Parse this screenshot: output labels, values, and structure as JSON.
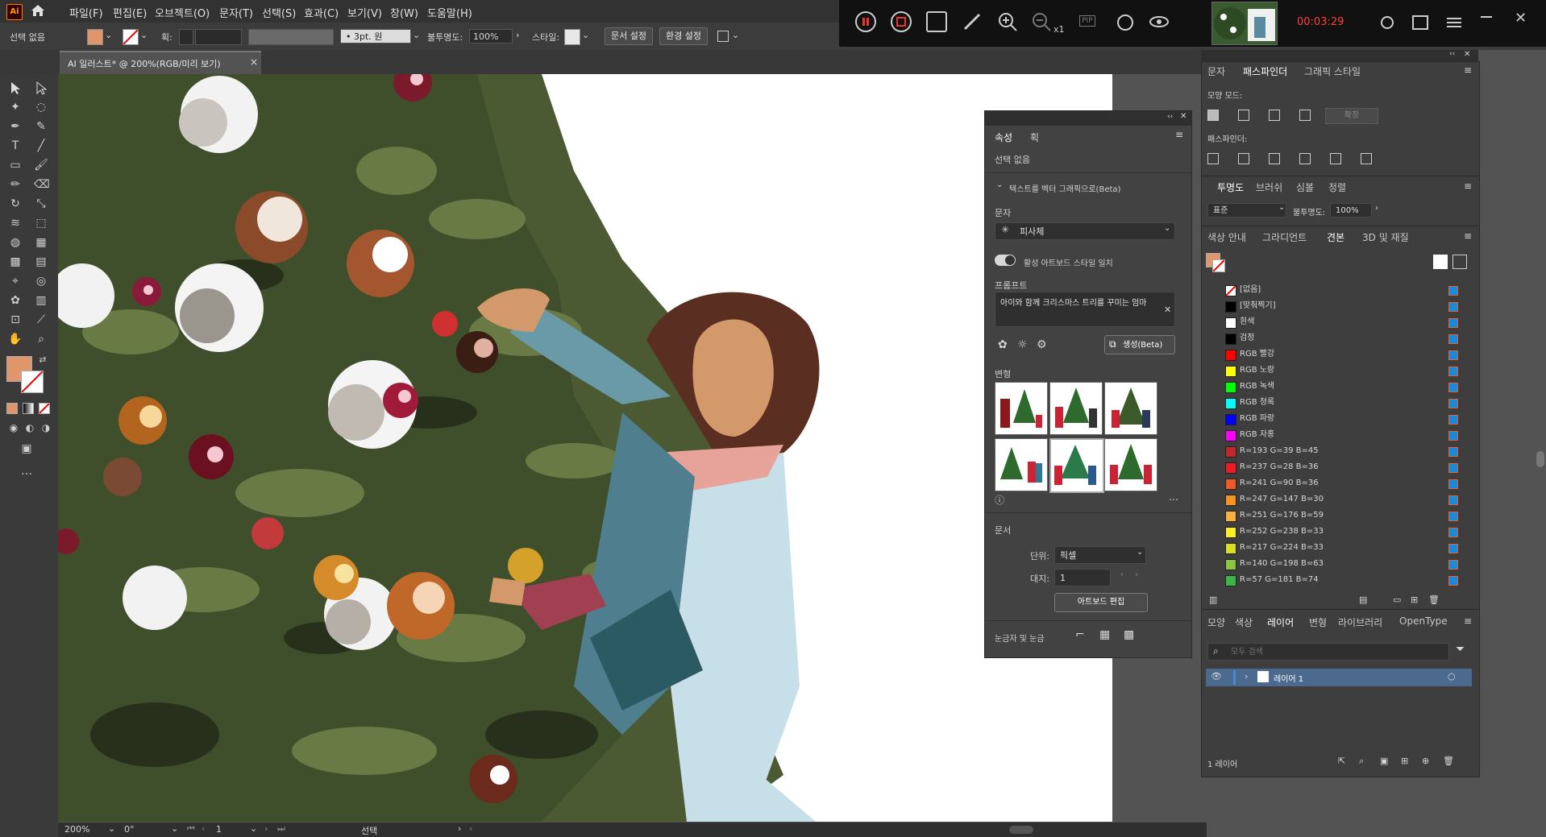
{
  "menu": {
    "logo": "Ai",
    "items": [
      "파일(F)",
      "편집(E)",
      "오브젝트(O)",
      "문자(T)",
      "선택(S)",
      "효과(C)",
      "보기(V)",
      "창(W)",
      "도움말(H)"
    ]
  },
  "control_bar": {
    "selection": "선택 없음",
    "stroke_label": "획:",
    "brush": "3pt. 원",
    "opacity_label": "불투명도:",
    "opacity_value": "100%",
    "style_label": "스타일:",
    "doc_setup": "문서 설정",
    "prefs": "환경 설정"
  },
  "recorder": {
    "time": "00:03:29",
    "zoom_suffix": "x1",
    "pip": "PIP"
  },
  "document_tab": {
    "title": "AI 일러스트* @ 200%(RGB/미리 보기)",
    "close": "×"
  },
  "status_bar": {
    "zoom": "200%",
    "rotation": "0°",
    "artboard": "1",
    "tool": "선택"
  },
  "properties_panel": {
    "tabs": [
      "속성",
      "획"
    ],
    "selection": "선택 없음",
    "section_vector": "텍스트를 벡터 그래픽으로(Beta)",
    "type_label": "문자",
    "type_value": "피사체",
    "toggle_label": "활성 아트보드 스타일 일치",
    "prompt_label": "프롬프트",
    "prompt_value": "아이와 함께 크리스마스 트리를 꾸미는 엄마",
    "generate": "생성(Beta)",
    "variations_label": "변형",
    "document_label": "문서",
    "unit_label": "단위:",
    "unit_value": "픽셀",
    "artboard_label": "대지:",
    "artboard_value": "1",
    "edit_artboard": "아트보드 편집",
    "rulers_label": "눈금자 및 눈금"
  },
  "pathfinder_panel": {
    "tabs": [
      "문자",
      "패스파인더",
      "그래픽 스타일"
    ],
    "shape_modes": "모양 모드:",
    "expand": "확장",
    "pathfinders": "패스파인더:"
  },
  "transparency_panel": {
    "tabs": [
      "투명도",
      "브러쉬",
      "심볼",
      "정렬"
    ],
    "blend": "표준",
    "opacity_label": "불투명도:",
    "opacity_value": "100%"
  },
  "swatches_panel": {
    "tabs": [
      "색상 안내",
      "그라디언트",
      "견본",
      "3D 및 재질"
    ],
    "swatches": [
      {
        "name": "[없음]",
        "color": "none"
      },
      {
        "name": "[맞춰찍기]",
        "color": "#000000"
      },
      {
        "name": "흰색",
        "color": "#ffffff"
      },
      {
        "name": "검정",
        "color": "#000000"
      },
      {
        "name": "RGB 빨강",
        "color": "#ff0000"
      },
      {
        "name": "RGB 노랑",
        "color": "#ffff00"
      },
      {
        "name": "RGB 녹색",
        "color": "#00ff00"
      },
      {
        "name": "RGB 청록",
        "color": "#00ffff"
      },
      {
        "name": "RGB 파랑",
        "color": "#0000ff"
      },
      {
        "name": "RGB 자홍",
        "color": "#ff00ff"
      },
      {
        "name": "R=193 G=39 B=45",
        "color": "#c1272d"
      },
      {
        "name": "R=237 G=28 B=36",
        "color": "#ed1c24"
      },
      {
        "name": "R=241 G=90 B=36",
        "color": "#f15a24"
      },
      {
        "name": "R=247 G=147 B=30",
        "color": "#f7931e"
      },
      {
        "name": "R=251 G=176 B=59",
        "color": "#fbb03b"
      },
      {
        "name": "R=252 G=238 B=33",
        "color": "#fcee21"
      },
      {
        "name": "R=217 G=224 B=33",
        "color": "#d9e021"
      },
      {
        "name": "R=140 G=198 B=63",
        "color": "#8cc63f"
      },
      {
        "name": "R=57 G=181 B=74",
        "color": "#39b54a"
      }
    ]
  },
  "layers_panel": {
    "tabs": [
      "모양",
      "색상",
      "레이어",
      "변형",
      "라이브러리",
      "OpenType"
    ],
    "search_placeholder": "모두 검색",
    "layer_name": "레이어 1",
    "footer": "1 레이어"
  },
  "colors": {
    "fill": "#e0956b",
    "accent": "#4b8bd6"
  }
}
